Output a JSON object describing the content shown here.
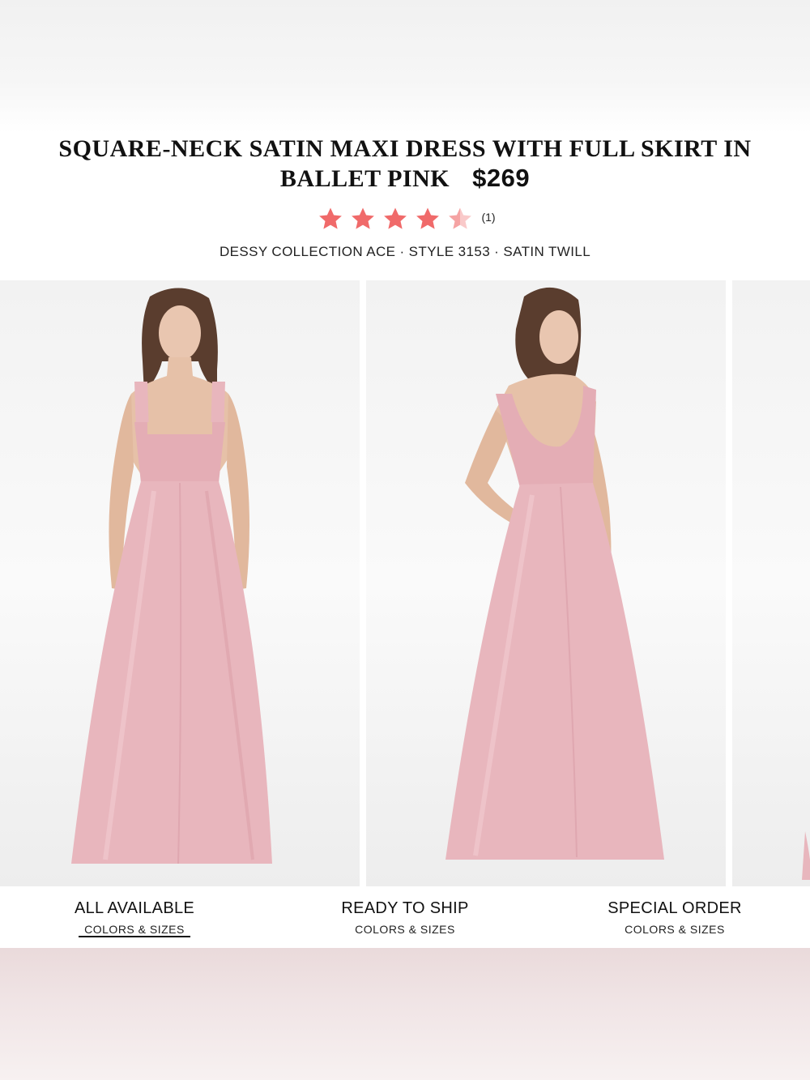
{
  "product": {
    "title": "SQUARE-NECK SATIN MAXI DRESS WITH FULL SKIRT IN BALLET PINK",
    "price": "$269",
    "rating": 4.5,
    "rating_max": 5,
    "review_count": "(1)",
    "meta": "DESSY COLLECTION ACE · STYLE 3153 · SATIN TWILL",
    "color_dress": "#e8b6bd",
    "color_star": "#f06a6a"
  },
  "gallery": {
    "images": [
      {
        "view": "front"
      },
      {
        "view": "back"
      },
      {
        "view": "partial"
      }
    ]
  },
  "tabs": [
    {
      "label": "ALL AVAILABLE",
      "sub": "COLORS & SIZES",
      "selected": true
    },
    {
      "label": "READY TO SHIP",
      "sub": "COLORS & SIZES",
      "selected": false
    },
    {
      "label": "SPECIAL ORDER",
      "sub": "COLORS & SIZES",
      "selected": false
    }
  ]
}
